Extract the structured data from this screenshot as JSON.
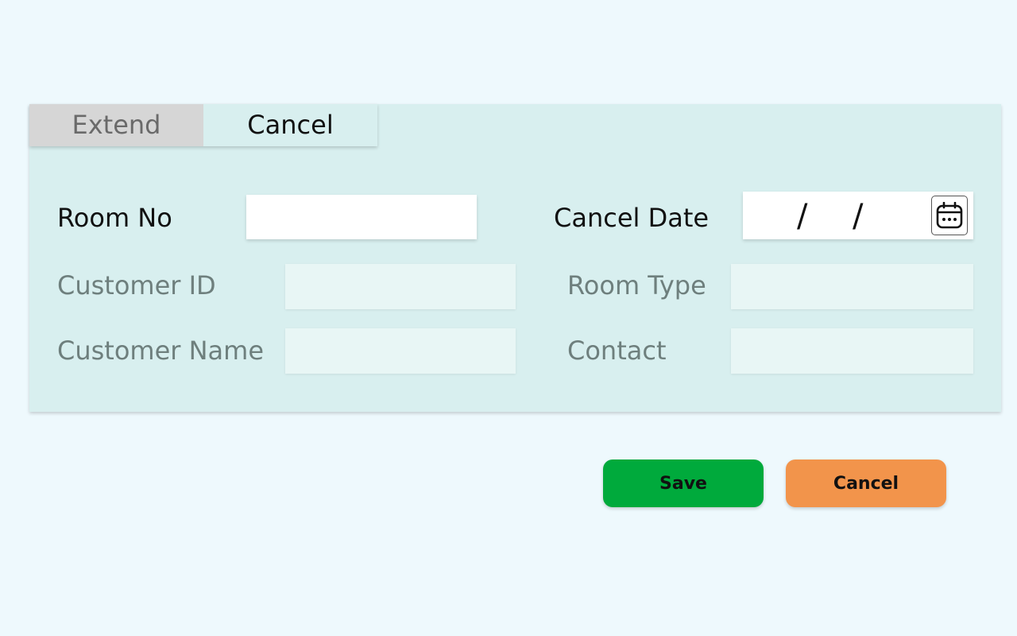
{
  "tabs": [
    {
      "label": "Extend",
      "active": false
    },
    {
      "label": "Cancel",
      "active": true
    }
  ],
  "form": {
    "room_no": {
      "label": "Room No",
      "value": ""
    },
    "cancel_date": {
      "label": "Cancel Date",
      "separator": "/",
      "icon": "calendar-icon"
    },
    "customer_id": {
      "label": "Customer ID",
      "value": ""
    },
    "customer_name": {
      "label": "Customer Name",
      "value": ""
    },
    "room_type": {
      "label": "Room Type",
      "value": ""
    },
    "contact": {
      "label": "Contact",
      "value": ""
    }
  },
  "buttons": {
    "save_label": "Save",
    "cancel_label": "Cancel",
    "save_color": "#00aa3c",
    "cancel_color": "#f2944b"
  }
}
